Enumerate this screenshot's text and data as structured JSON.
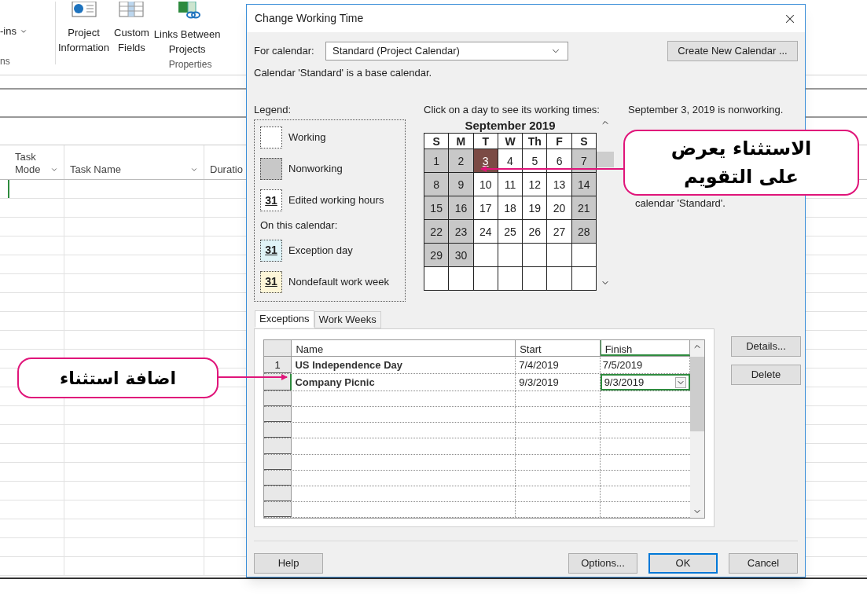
{
  "ribbon": {
    "addins": {
      "label": "-ins"
    },
    "left_group_label": "ns",
    "buttons": [
      {
        "kind": "info",
        "lines": [
          "Project",
          "Information"
        ]
      },
      {
        "kind": "table",
        "lines": [
          "Custom",
          "Fields"
        ]
      },
      {
        "kind": "link",
        "lines": [
          "Links Between",
          "Projects"
        ]
      }
    ],
    "group_label": "Properties"
  },
  "grid": {
    "columns": [
      {
        "lines": [
          "Task",
          "Mode"
        ],
        "dropdown": true
      },
      {
        "lines": [
          "Task Name"
        ],
        "dropdown": true
      },
      {
        "lines": [
          "Duratio"
        ]
      }
    ]
  },
  "dialog": {
    "title": "Change Working Time",
    "for_calendar": {
      "label": "For calendar:",
      "value": "Standard (Project Calendar)"
    },
    "create_button": "Create New Calendar ...",
    "base_note": "Calendar 'Standard' is a base calendar.",
    "legend": {
      "title": "Legend:",
      "sections": [
        {
          "items": [
            {
              "kind": "working",
              "label": "Working"
            },
            {
              "kind": "nonworking",
              "label": "Nonworking"
            },
            {
              "kind": "edited",
              "number": "31",
              "label": "Edited working hours"
            }
          ]
        },
        {
          "heading": "On this calendar:",
          "items": [
            {
              "kind": "exception",
              "number": "31",
              "label": "Exception day"
            },
            {
              "kind": "nondefault",
              "number": "31",
              "label": "Nondefault work week"
            }
          ]
        }
      ]
    },
    "calendar": {
      "instruction": "Click on a day to see its working times:",
      "month": "September 2019",
      "weekdays": [
        "S",
        "M",
        "T",
        "W",
        "Th",
        "F",
        "S"
      ],
      "days": [
        {
          "day": "1",
          "nonworking": true,
          "selected": false
        },
        {
          "day": "2",
          "nonworking": true,
          "selected": false
        },
        {
          "day": "3",
          "nonworking": true,
          "selected": true
        },
        {
          "day": "4",
          "nonworking": false,
          "selected": false
        },
        {
          "day": "5",
          "nonworking": false,
          "selected": false
        },
        {
          "day": "6",
          "nonworking": false,
          "selected": false
        },
        {
          "day": "7",
          "nonworking": true,
          "selected": false
        },
        {
          "day": "8",
          "nonworking": true,
          "selected": false
        },
        {
          "day": "9",
          "nonworking": true,
          "selected": false
        },
        {
          "day": "10",
          "nonworking": false,
          "selected": false
        },
        {
          "day": "11",
          "nonworking": false,
          "selected": false
        },
        {
          "day": "12",
          "nonworking": false,
          "selected": false
        },
        {
          "day": "13",
          "nonworking": false,
          "selected": false
        },
        {
          "day": "14",
          "nonworking": true,
          "selected": false
        },
        {
          "day": "15",
          "nonworking": true,
          "selected": false
        },
        {
          "day": "16",
          "nonworking": true,
          "selected": false
        },
        {
          "day": "17",
          "nonworking": false,
          "selected": false
        },
        {
          "day": "18",
          "nonworking": false,
          "selected": false
        },
        {
          "day": "19",
          "nonworking": false,
          "selected": false
        },
        {
          "day": "20",
          "nonworking": false,
          "selected": false
        },
        {
          "day": "21",
          "nonworking": true,
          "selected": false
        },
        {
          "day": "22",
          "nonworking": true,
          "selected": false
        },
        {
          "day": "23",
          "nonworking": true,
          "selected": false
        },
        {
          "day": "24",
          "nonworking": false,
          "selected": false
        },
        {
          "day": "25",
          "nonworking": false,
          "selected": false
        },
        {
          "day": "26",
          "nonworking": false,
          "selected": false
        },
        {
          "day": "27",
          "nonworking": false,
          "selected": false
        },
        {
          "day": "28",
          "nonworking": true,
          "selected": false
        },
        {
          "day": "29",
          "nonworking": true,
          "selected": false
        },
        {
          "day": "30",
          "nonworking": true,
          "selected": false
        }
      ]
    },
    "status": {
      "message": "September 3, 2019 is nonworking.",
      "detail": "calendar 'Standard'."
    },
    "tabs": [
      {
        "label": "Exceptions",
        "selected": true
      },
      {
        "label": "Work Weeks",
        "selected": false
      }
    ],
    "exceptions": {
      "columns": [
        "Name",
        "Start",
        "Finish"
      ],
      "rows": [
        {
          "row_header": "1",
          "name": "US Independence Day",
          "start": "7/4/2019",
          "finish": "7/5/2019",
          "selected": false
        },
        {
          "name": "Company Picnic",
          "start": "9/3/2019",
          "finish": "9/3/2019",
          "selected": true
        }
      ]
    },
    "side_buttons": [
      "Details...",
      "Delete"
    ],
    "footer": {
      "help": "Help",
      "buttons": [
        {
          "label": "Options...",
          "default": false
        },
        {
          "label": "OK",
          "default": true
        },
        {
          "label": "Cancel",
          "default": false
        }
      ]
    }
  },
  "callouts": [
    {
      "lines": [
        "الاستثناء يعرض",
        "على التقويم"
      ]
    },
    {
      "lines": [
        "اضافة استثناء"
      ]
    }
  ]
}
